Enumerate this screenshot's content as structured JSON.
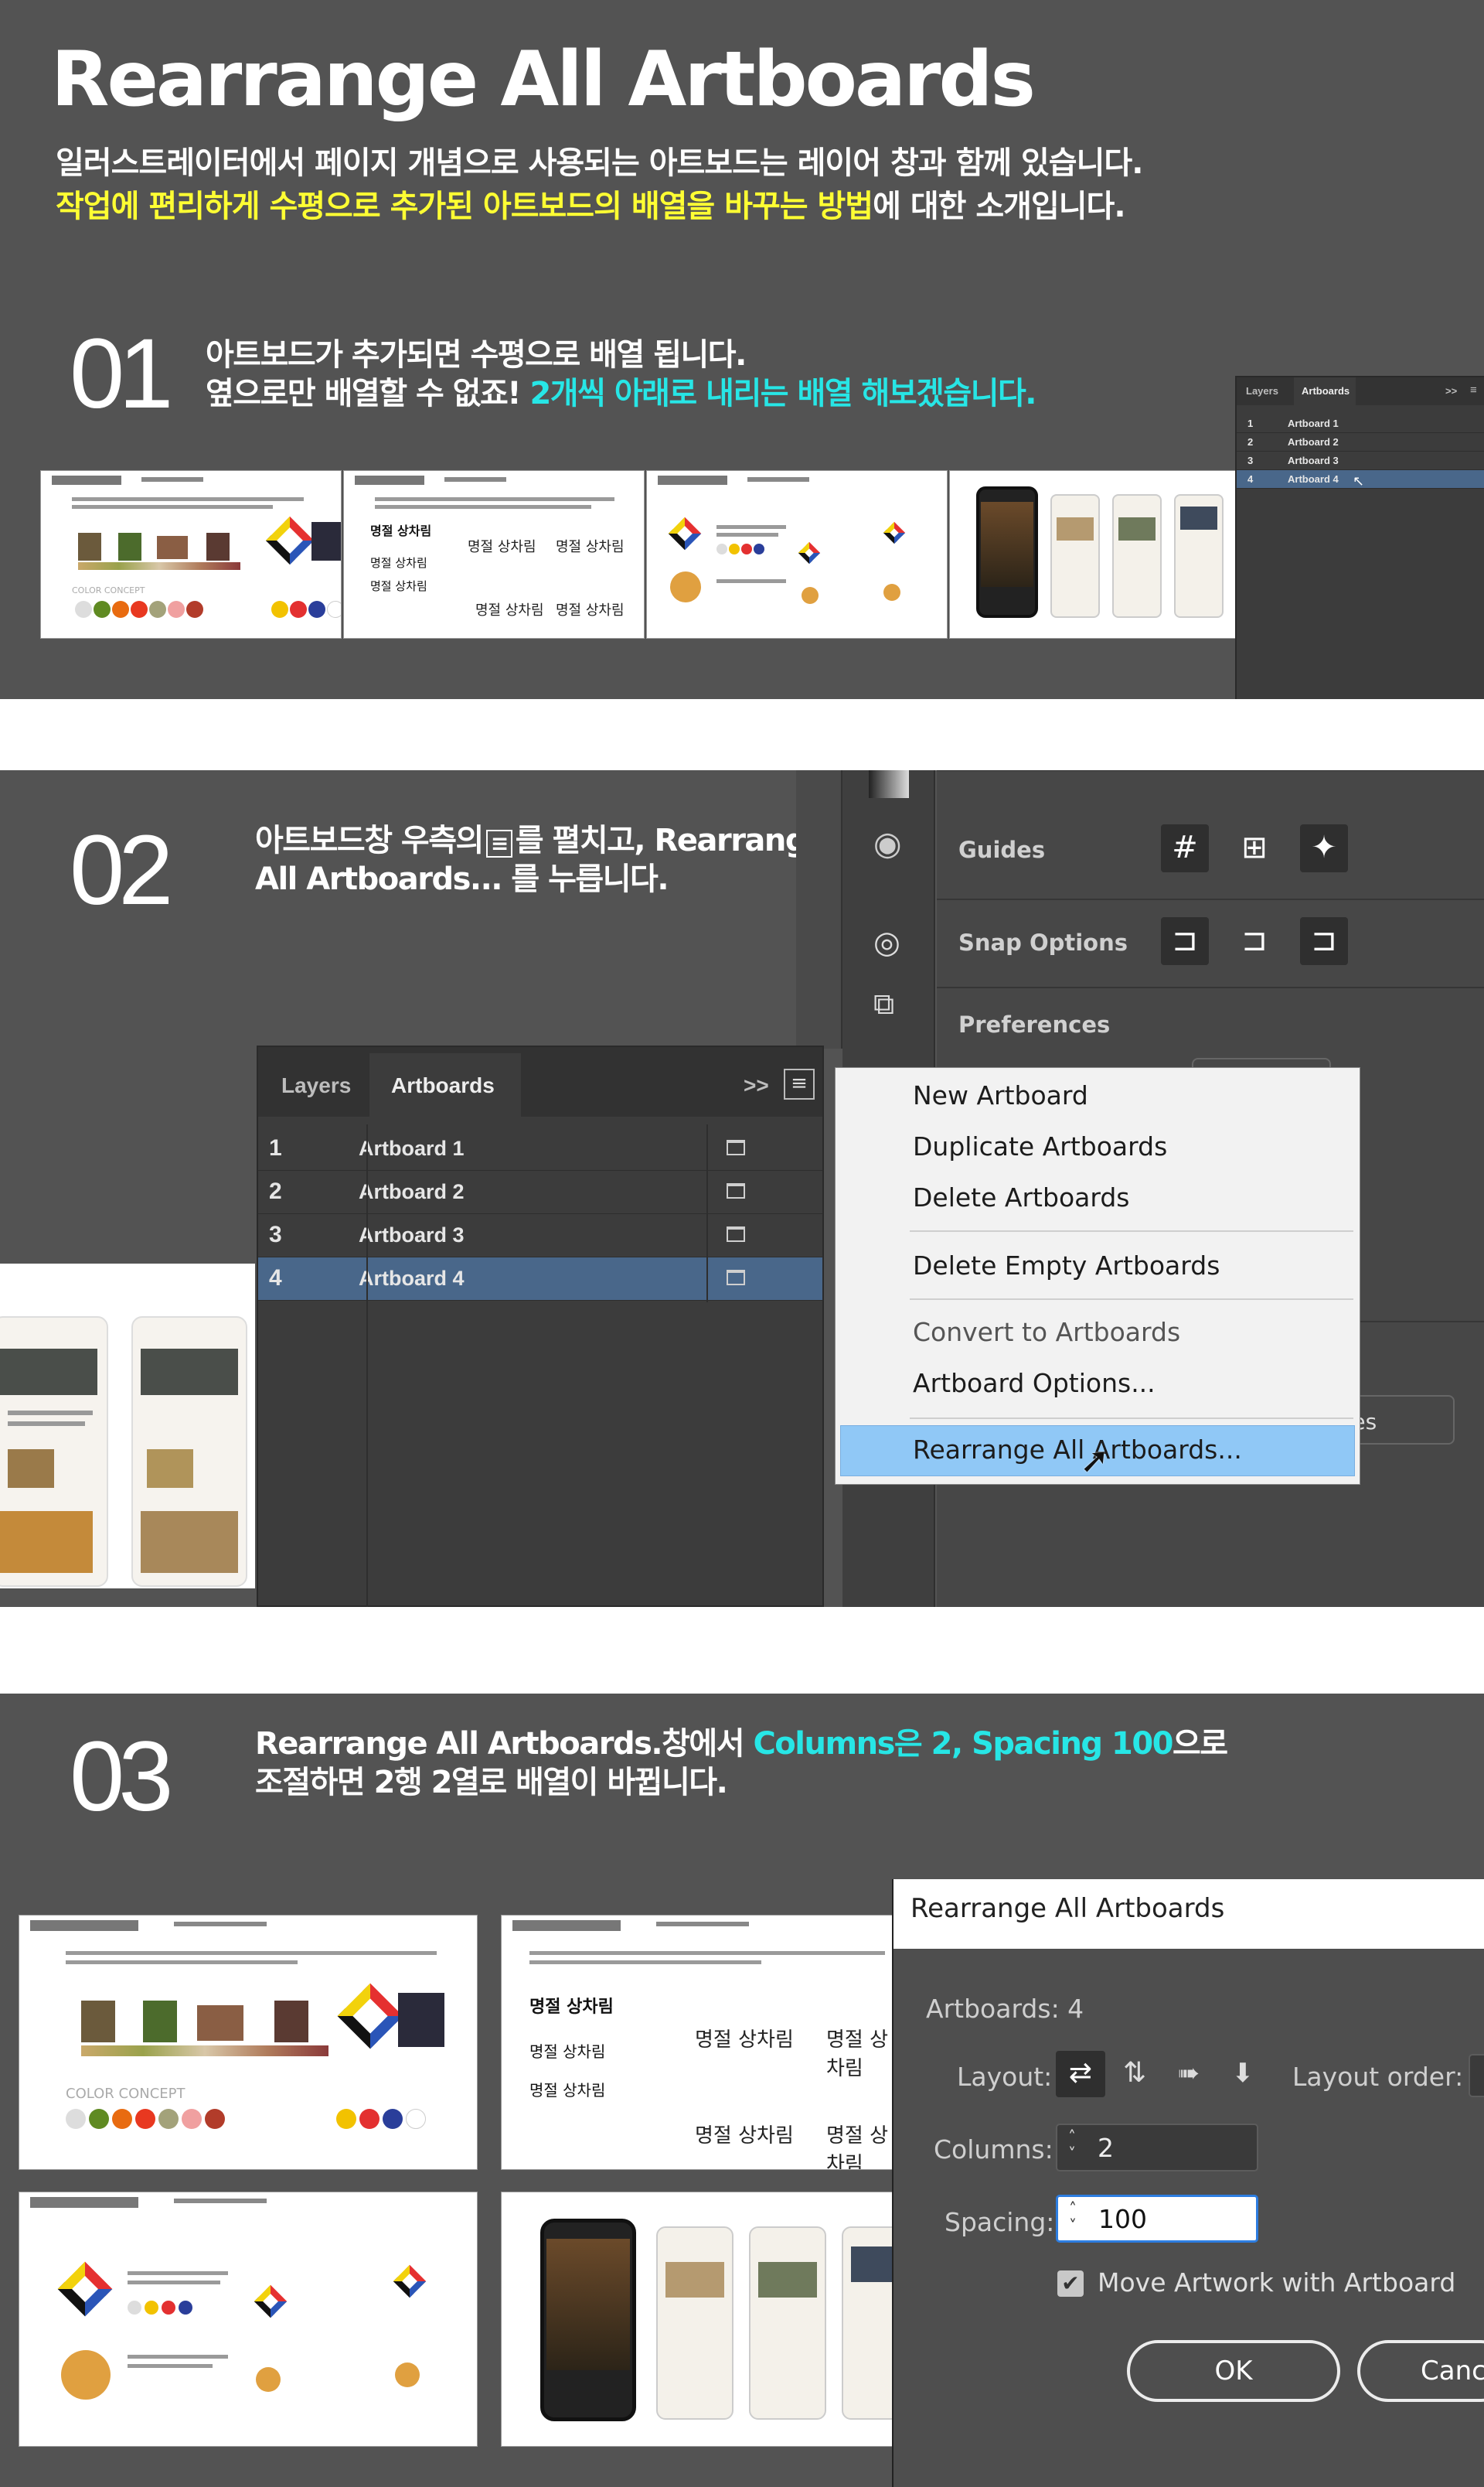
{
  "header": {
    "title": "Rearrange All Artboards",
    "intro_line1": "일러스트레이터에서 페이지 개념으로 사용되는 아트보드는 레이어 창과 함께 있습니다.",
    "intro_line2_highlight": "작업에 편리하게 수평으로 추가된 아트보드의 배열을 바꾸는 방법",
    "intro_line2_rest": "에 대한 소개입니다."
  },
  "step1": {
    "number": "01",
    "line1": "아트보드가 추가되면 수평으로  배열 됩니다.",
    "line2_plain": "옆으로만 배열할 수 없죠!",
    "line2_highlight": " 2개씩 아래로  내리는 배열 해보겠습니다."
  },
  "step2": {
    "number": "02",
    "line1_a": "아트보드창 우측의",
    "line1_icon": "≡",
    "line1_b": "를 펼치고, Rearrange",
    "line2": "All Artboards... 를 누릅니다."
  },
  "step3": {
    "number": "03",
    "line1_plain": "Rearrange All Artboards.창에서 ",
    "line1_highlight": "Columns은 2,  Spacing 100",
    "line1_rest": "으로",
    "line2": "조절하면 2행 2열로 배열이 바뀝니다."
  },
  "artboards_panel": {
    "tab_layers": "Layers",
    "tab_artboards": "Artboards",
    "collapse": ">>",
    "rows": [
      {
        "num": "1",
        "name": "Artboard 1"
      },
      {
        "num": "2",
        "name": "Artboard 2"
      },
      {
        "num": "3",
        "name": "Artboard 3"
      },
      {
        "num": "4",
        "name": "Artboard 4"
      }
    ]
  },
  "properties": {
    "guides": "Guides",
    "snap_options": "Snap Options",
    "preferences": "Preferences",
    "button_fragment": "ces"
  },
  "menu": {
    "items": [
      "New Artboard",
      "Duplicate Artboards",
      "Delete Artboards",
      "Delete Empty Artboards",
      "Convert to Artboards",
      "Artboard Options...",
      "Rearrange All Artboards..."
    ]
  },
  "dialog": {
    "title": "Rearrange All Artboards",
    "artboards_count": "Artboards: 4",
    "layout_label": "Layout:",
    "layout_order_label": "Layout order:",
    "columns_label": "Columns:",
    "columns_value": "2",
    "spacing_label": "Spacing:",
    "spacing_value": "100",
    "move_artwork": "Move Artwork with Artboard",
    "ok": "OK",
    "cancel": "Canc"
  },
  "thumbs": {
    "color_concept": "COLOR CONCEPT",
    "calligraphy": "명절 상차림",
    "calligraphy_alt": "명절 상차림"
  },
  "colors": {
    "bg": "#535353",
    "yellow": "#ffff33",
    "cyan": "#27e6e6",
    "selected_row": "#49678a",
    "menu_highlight": "#90c8f6"
  }
}
